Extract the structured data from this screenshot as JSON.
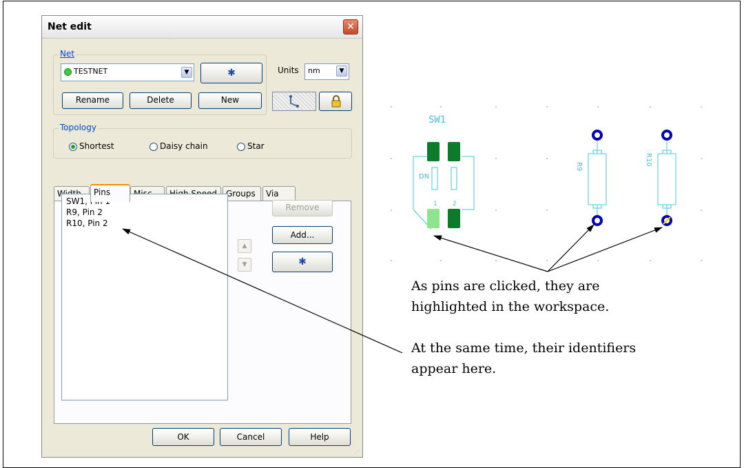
{
  "dialog": {
    "title": "Net edit",
    "close_glyph": "✕",
    "net": {
      "legend": "Net",
      "selected": "TESTNET",
      "units_label": "Units",
      "units_value": "nm",
      "rename_label": "Rename",
      "delete_label": "Delete",
      "new_label": "New"
    },
    "topology": {
      "legend": "Topology",
      "options": [
        "Shortest",
        "Daisy chain",
        "Star"
      ],
      "selected": "Shortest"
    },
    "tabs": [
      "Width",
      "Pins",
      "Misc",
      "High Speed",
      "Groups",
      "Via"
    ],
    "active_tab": "Pins",
    "pins": [
      "SW1, Pin 1",
      "R9, Pin 2",
      "R10, Pin 2"
    ],
    "remove_label": "Remove",
    "add_label": "Add...",
    "ok_label": "OK",
    "cancel_label": "Cancel",
    "help_label": "Help"
  },
  "workspace": {
    "component_label": "SW1",
    "switch_text": "DN",
    "switch_pin_numbers": [
      "1",
      "2"
    ],
    "resistor_labels": [
      "R9",
      "R10"
    ]
  },
  "annotations": {
    "caption1": [
      "As pins are clicked, they are",
      "highlighted in the workspace."
    ],
    "caption2": [
      "At the same time, their identifiers",
      "appear here."
    ]
  },
  "colors": {
    "pad_dark": "#0d7a2c",
    "pad_highlight": "#8ee58e",
    "outline": "#44c4d8",
    "via": "#0000b4",
    "net_indicator": "#3ecb3e",
    "legend_text": "#0046d5"
  }
}
